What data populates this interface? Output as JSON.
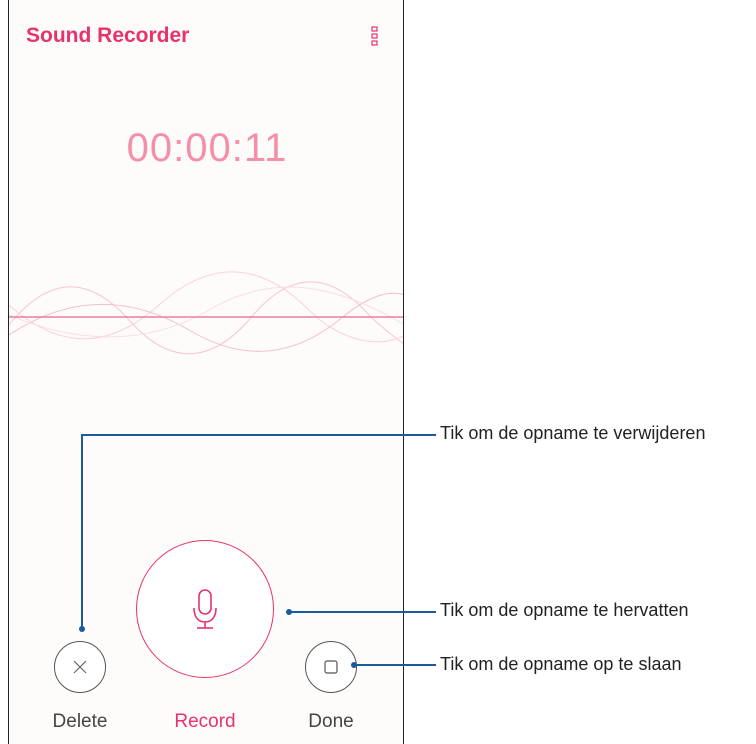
{
  "app": {
    "title": "Sound Recorder"
  },
  "recorder": {
    "timer": "00:00:11"
  },
  "controls": {
    "delete_label": "Delete",
    "record_label": "Record",
    "done_label": "Done"
  },
  "callouts": {
    "delete": "Tik om de opname te verwijderen",
    "record": "Tik om de opname te hervatten",
    "done": "Tik om de opname op te slaan"
  },
  "colors": {
    "accent": "#e8336a",
    "timer": "#f48fa7",
    "callout": "#1b5a9c"
  },
  "icons": {
    "menu": "more-vert-icon",
    "delete": "close-icon",
    "record": "microphone-icon",
    "done": "stop-icon"
  }
}
